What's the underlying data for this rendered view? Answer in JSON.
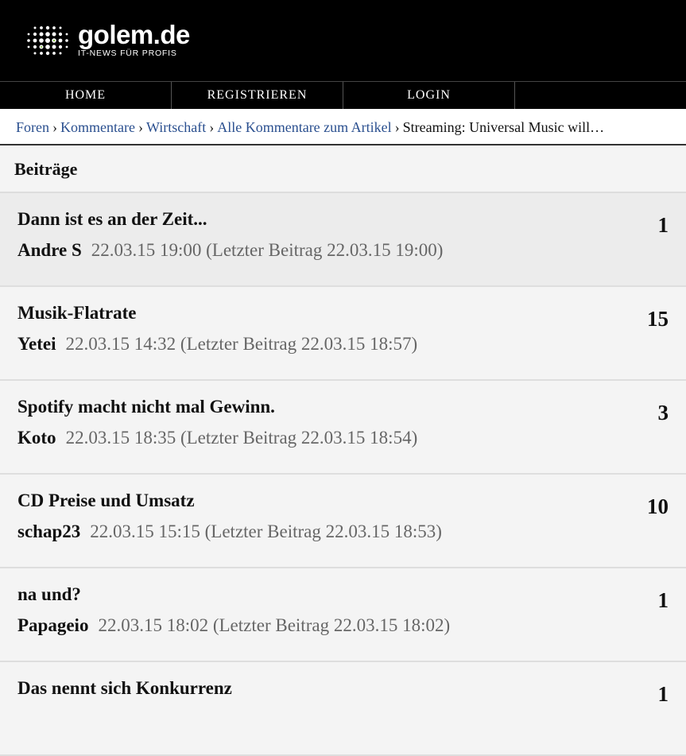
{
  "header": {
    "logo_name": "golem.de",
    "logo_tagline": "IT-NEWS FÜR PROFIS"
  },
  "nav": {
    "items": [
      {
        "label": "HOME"
      },
      {
        "label": "REGISTRIEREN"
      },
      {
        "label": "LOGIN"
      }
    ]
  },
  "breadcrumb": {
    "items": [
      {
        "label": "Foren"
      },
      {
        "label": "Kommentare"
      },
      {
        "label": "Wirtschaft"
      },
      {
        "label": "Alle Kommentare zum Artikel"
      }
    ],
    "current": "Streaming: Universal Music will…"
  },
  "section": {
    "title": "Beiträge"
  },
  "posts": [
    {
      "title": "Dann ist es an der Zeit...",
      "author": "Andre S",
      "date": "22.03.15 19:00 (Letzter Beitrag 22.03.15 19:00)",
      "count": "1"
    },
    {
      "title": "Musik-Flatrate",
      "author": "Yetei",
      "date": "22.03.15 14:32 (Letzter Beitrag 22.03.15 18:57)",
      "count": "15"
    },
    {
      "title": "Spotify macht nicht mal Gewinn.",
      "author": "Koto",
      "date": "22.03.15 18:35 (Letzter Beitrag 22.03.15 18:54)",
      "count": "3"
    },
    {
      "title": "CD Preise und Umsatz",
      "author": "schap23",
      "date": "22.03.15 15:15 (Letzter Beitrag 22.03.15 18:53)",
      "count": "10"
    },
    {
      "title": "na und?",
      "author": "Papageio",
      "date": "22.03.15 18:02 (Letzter Beitrag 22.03.15 18:02)",
      "count": "1"
    },
    {
      "title": "Das nennt sich Konkurrenz",
      "author": "",
      "date": "",
      "count": "1"
    }
  ]
}
